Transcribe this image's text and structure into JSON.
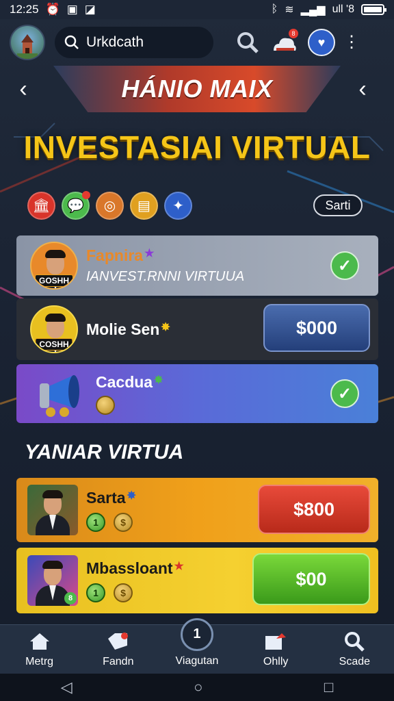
{
  "status": {
    "time": "12:25",
    "right_text": "ull '8"
  },
  "search": {
    "value": "Urkdcath"
  },
  "banner": {
    "title": "HÁNIO MAIX"
  },
  "main_title": "INVESTASIAI VIRTUAL",
  "filter_chip": "Sarti",
  "cards": [
    {
      "name": "Fapnira",
      "subtitle": "IANVEST.RNNI VIRTUUA",
      "badge": "GOSHH",
      "status": "checked"
    },
    {
      "name": "Molie Sen",
      "badge": "COSHH",
      "price": "$000"
    },
    {
      "name": "Cacdua",
      "status": "checked"
    }
  ],
  "section_title": "YANIAR VIRTUA",
  "offers": [
    {
      "name": "Sarta",
      "price": "$800",
      "coin_label": "1"
    },
    {
      "name": "Mbassloant",
      "price": "$00",
      "coin_label": "1",
      "avatar_badge": "8"
    }
  ],
  "nav": [
    {
      "label": "Metrg",
      "icon": "home-icon"
    },
    {
      "label": "Fandn",
      "icon": "tag-icon",
      "badge": "•"
    },
    {
      "label": "Viagutan",
      "icon": "number-icon",
      "number": "1"
    },
    {
      "label": "Ohlly",
      "icon": "heart-chat-icon"
    },
    {
      "label": "Scade",
      "icon": "search-icon"
    }
  ],
  "colors": {
    "accent_yellow": "#f5c518",
    "check_green": "#4cba4c",
    "price_red": "#d9342a",
    "price_green": "#5bbf2a",
    "price_blue": "#2d4e8e"
  }
}
